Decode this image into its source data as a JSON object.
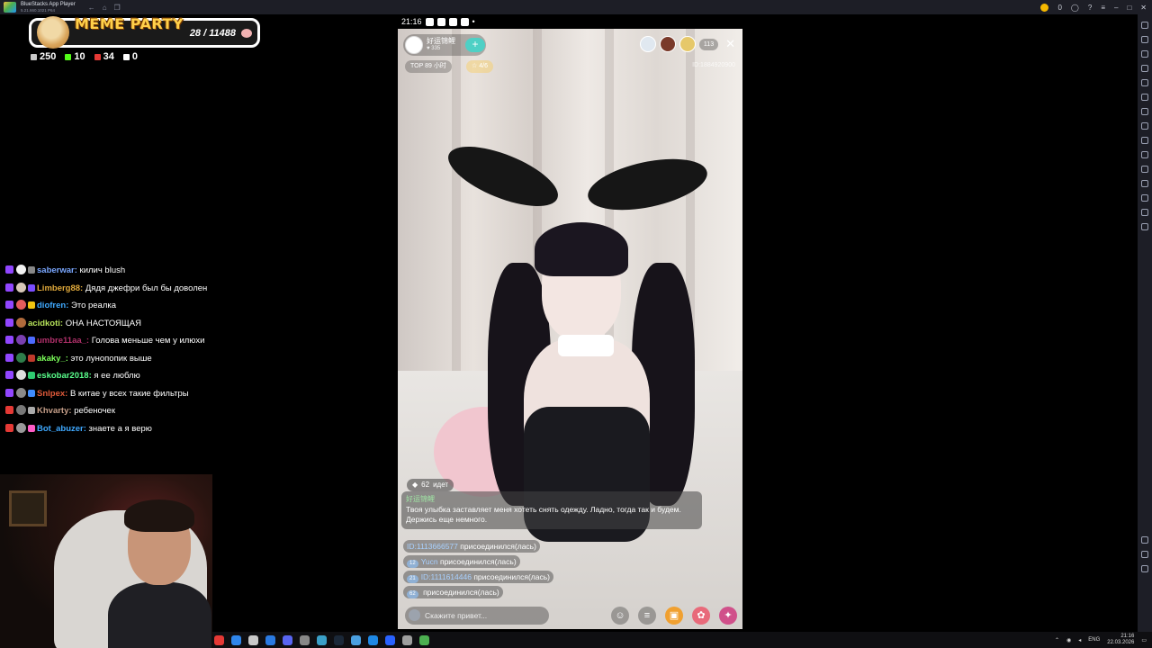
{
  "bluestacks": {
    "title": "BlueStacks App Player",
    "subtitle": "5.21.660.1021 P64",
    "coins": "0"
  },
  "overlay": {
    "banner_title": "MEME PARTY",
    "banner_score": "28 / 11488",
    "stats": [
      {
        "value": "250",
        "color": "#c9c9c9"
      },
      {
        "value": "10",
        "color": "#53fc18"
      },
      {
        "value": "34",
        "color": "#e53935"
      },
      {
        "value": "0",
        "color": "#ffffff"
      }
    ]
  },
  "chat": [
    {
      "user": "saberwar:",
      "text": "килич blush",
      "color": "#7aa7ff",
      "badge": "#9146ff",
      "avatar": "#f2f2f2",
      "sub": "#888888"
    },
    {
      "user": "Limberg88:",
      "text": "Дядя джефри был бы доволен",
      "color": "#e0a93b",
      "badge": "#9146ff",
      "avatar": "#d8c8b8",
      "sub": "#7b4dff"
    },
    {
      "user": "diofren:",
      "text": "Это реалка",
      "color": "#3fa9ff",
      "badge": "#9146ff",
      "avatar": "#e35c5c",
      "sub": "#f1c40f"
    },
    {
      "user": "acidkoti:",
      "text": "ОНА НАСТОЯЩАЯ",
      "color": "#b6e25a",
      "badge": "#9146ff",
      "avatar": "#b06a3b",
      "sub": ""
    },
    {
      "user": "umbre11aa_:",
      "text": "Голова меньше чем у илюхи",
      "color": "#b0306a",
      "badge": "#9146ff",
      "avatar": "#7a3fb0",
      "sub": "#4d6bff"
    },
    {
      "user": "akaky_:",
      "text": "это лунопопик выше",
      "color": "#7cff5a",
      "badge": "#9146ff",
      "avatar": "#2f7d4a",
      "sub": "#c0392b"
    },
    {
      "user": "eskobar2018:",
      "text": "я ее люблю",
      "color": "#5aff8c",
      "badge": "#9146ff",
      "avatar": "#dddddd",
      "sub": "#2ecc71"
    },
    {
      "user": "Snlpex:",
      "text": "В китае у всех такие фильтры",
      "color": "#e05a3a",
      "badge": "#9146ff",
      "avatar": "#8a8a8a",
      "sub": "#3f8cff"
    },
    {
      "user": "Khvarty:",
      "text": "ребеночек",
      "color": "#c7a08a",
      "badge": "#e53935",
      "avatar": "#777777",
      "sub": "#aaaaaa"
    },
    {
      "user": "Bot_abuzer:",
      "text": "знаете а я верю",
      "color": "#3fa9ff",
      "badge": "#e53935",
      "avatar": "#999999",
      "sub": "#ff5cc6"
    }
  ],
  "phone": {
    "time": "21:16",
    "host_name": "好运锦鲤",
    "host_likes": "335",
    "follow_label": "+",
    "rank_pill": "TOP 89 小时",
    "guests_pill": "4/6",
    "viewer_count": "113",
    "room_id": "ID:1884920900",
    "level_badge": "62",
    "level_text": "идет",
    "bubble_user": "好运锦鲤",
    "bubble_text": "Твоя улыбка заставляет меня хотеть снять одежду. Ладно, тогда так и будем. Держись еще немного.",
    "system_messages": [
      {
        "level": "",
        "name": "ID:1113666577",
        "action": "присоединился(лась)"
      },
      {
        "level": "12",
        "name": "Yucn",
        "action": "присоединился(лась)"
      },
      {
        "level": "21",
        "name": "ID:1111614446",
        "action": "присоединился(лась)"
      },
      {
        "level": "62",
        "name": "",
        "action": "присоединился(лась)"
      }
    ],
    "input_placeholder": "Скажите привет..."
  },
  "taskbar": {
    "lang": "ENG",
    "time": "21:16",
    "date": "22.03.2026"
  }
}
